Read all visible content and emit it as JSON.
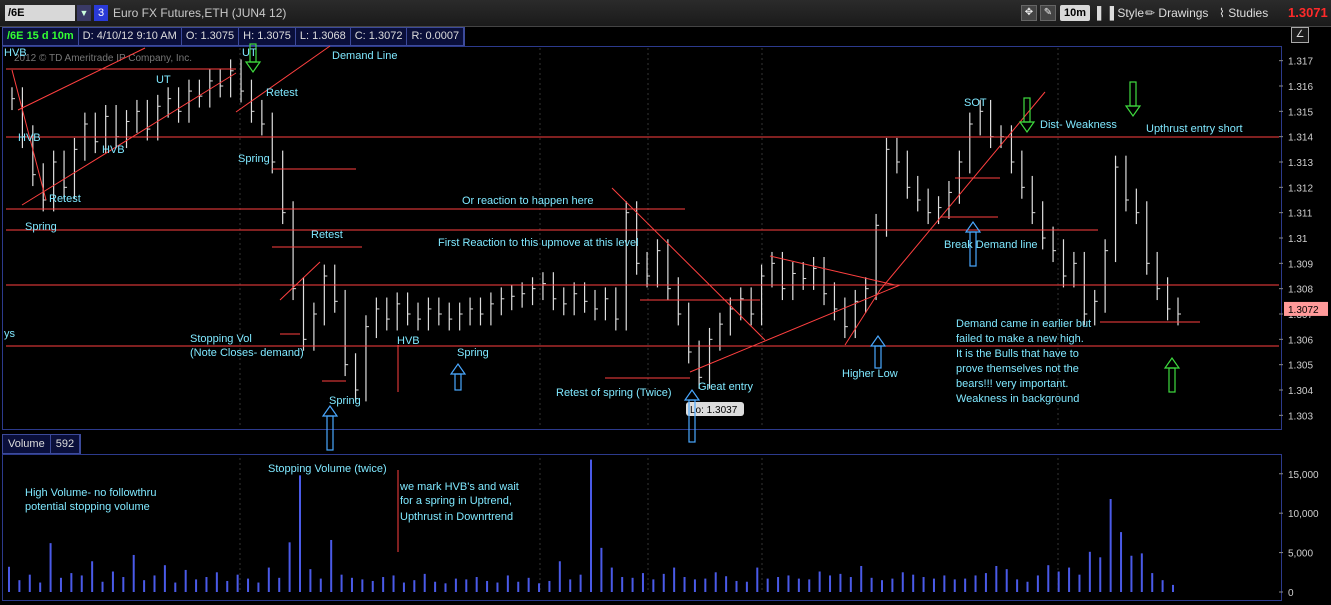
{
  "toolbar": {
    "symbol": "/6E",
    "link_number": "3",
    "description": "Euro FX Futures,ETH (JUN4 12)",
    "aggregation": "10m",
    "style_label": "Style",
    "drawings_label": "Drawings",
    "studies_label": "Studies",
    "last_price": "1.3071"
  },
  "info": {
    "symbol_tf": "/6E 15 d 10m",
    "date": "D: 4/10/12 9:10 AM",
    "open": "O: 1.3075",
    "high": "H: 1.3075",
    "low": "L: 1.3068",
    "close": "C: 1.3072",
    "range": "R: 0.0007"
  },
  "watermark": "2012 © TD Ameritrade IP Company, Inc.",
  "volume": {
    "label": "Volume",
    "value": "592"
  },
  "colors": {
    "up": "#dedede",
    "bear": "#ff4040",
    "annotation": "#7fe8ff",
    "volume": "#4a5ae8",
    "last_price_tag": "#ff9a9a"
  },
  "chart_data": [
    {
      "type": "line",
      "title": "/6E 15 d 10m",
      "ylim": [
        1.3025,
        1.3175
      ],
      "yticks": [
        "1.317",
        "1.316",
        "1.315",
        "1.314",
        "1.313",
        "1.312",
        "1.311",
        "1.31",
        "1.309",
        "1.308",
        "1.307",
        "1.306",
        "1.305",
        "1.304",
        "1.303"
      ],
      "series": [
        {
          "values": [
            1.3155,
            1.314,
            1.3125,
            1.3115,
            1.313,
            1.312,
            1.3135,
            1.3145,
            1.3138,
            1.3148,
            1.314,
            1.3146,
            1.315,
            1.3143,
            1.3152,
            1.3155,
            1.315,
            1.3158,
            1.3156,
            1.3162,
            1.316,
            1.3166,
            1.3158,
            1.315,
            1.3145,
            1.313,
            1.311,
            1.308,
            1.306,
            1.307,
            1.3085,
            1.3075,
            1.305,
            1.304,
            1.3065,
            1.3072,
            1.3068,
            1.3074,
            1.307,
            1.3068,
            1.3072,
            1.307,
            1.3068,
            1.307,
            1.3072,
            1.307,
            1.3074,
            1.3076,
            1.3077,
            1.3078,
            1.308,
            1.3082,
            1.3076,
            1.3074,
            1.3078,
            1.3075,
            1.3072,
            1.3076,
            1.3068,
            1.311,
            1.309,
            1.3085,
            1.3095,
            1.308,
            1.307,
            1.3055,
            1.3045,
            1.306,
            1.3066,
            1.3072,
            1.3076,
            1.307,
            1.3085,
            1.309,
            1.308,
            1.3086,
            1.3084,
            1.3088,
            1.3078,
            1.3072,
            1.3065,
            1.3075,
            1.308,
            1.3105,
            1.3135,
            1.313,
            1.312,
            1.3115,
            1.311,
            1.3112,
            1.3118,
            1.313,
            1.3145,
            1.315,
            1.314,
            1.314,
            1.313,
            1.312,
            1.311,
            1.31,
            1.3095,
            1.3085,
            1.309,
            1.307,
            1.3075,
            1.3095,
            1.3128,
            1.3115,
            1.311,
            1.309,
            1.308,
            1.3072,
            1.307
          ]
        }
      ],
      "last_price_label": "1.3072",
      "low_label": "Lo: 1.3037",
      "annotations": [
        "HVB",
        "UT",
        "HVB",
        "HVB",
        "Retest",
        "Spring",
        "Demand Line",
        "Retest",
        "Spring",
        "Retest",
        "Stopping Vol",
        "(Note Closes- demand)",
        "Spring",
        "HVB",
        "Spring",
        "Or reaction to happen here",
        "First Reaction to this upmove at this level",
        "Retest of spring (Twice)",
        "Great entry",
        "Higher Low",
        "SOT",
        "Dist- Weakness",
        "Upthrust entry short",
        "Break Demand line",
        "Demand came in earlier but",
        "failed to make a new high.",
        "It is the Bulls that have to",
        "prove themselves not the",
        "bears!!! very important.",
        "Weakness in background",
        "ys"
      ]
    },
    {
      "type": "bar",
      "title": "Volume",
      "ylim": [
        0,
        17000
      ],
      "yticks": [
        "15,000",
        "10,000",
        "5,000",
        "0"
      ],
      "values": [
        3200,
        1500,
        2200,
        1200,
        6200,
        1800,
        2400,
        2100,
        3900,
        1300,
        2600,
        1900,
        4700,
        1500,
        2100,
        3400,
        1200,
        2800,
        1600,
        1900,
        2500,
        1400,
        2200,
        1700,
        1200,
        3100,
        1800,
        6300,
        14800,
        2900,
        1700,
        6600,
        2200,
        1800,
        1600,
        1400,
        1900,
        2100,
        1200,
        1500,
        2300,
        1300,
        1100,
        1700,
        1600,
        1900,
        1400,
        1200,
        2100,
        1300,
        1800,
        1100,
        1400,
        3900,
        1600,
        2200,
        16800,
        5600,
        3100,
        1900,
        1800,
        2400,
        1600,
        2300,
        3100,
        1900,
        1600,
        1700,
        2500,
        2000,
        1400,
        1300,
        3100,
        1700,
        1900,
        2100,
        1700,
        1600,
        2600,
        2100,
        2300,
        1900,
        3300,
        1800,
        1500,
        1700,
        2500,
        2200,
        1900,
        1700,
        2100,
        1600,
        1700,
        2100,
        2400,
        3300,
        2900,
        1600,
        1300,
        2100,
        3400,
        2600,
        3100,
        2200,
        5100,
        4400,
        11800,
        7600,
        4600,
        4900,
        2400,
        1500,
        900
      ],
      "annotations": [
        "High Volume- no followthru",
        "potential stopping volume",
        "Stopping Volume (twice)",
        "we mark HVB's and wait",
        "for a spring in Uptrend,",
        "Upthrust in Downrtrend"
      ]
    }
  ]
}
